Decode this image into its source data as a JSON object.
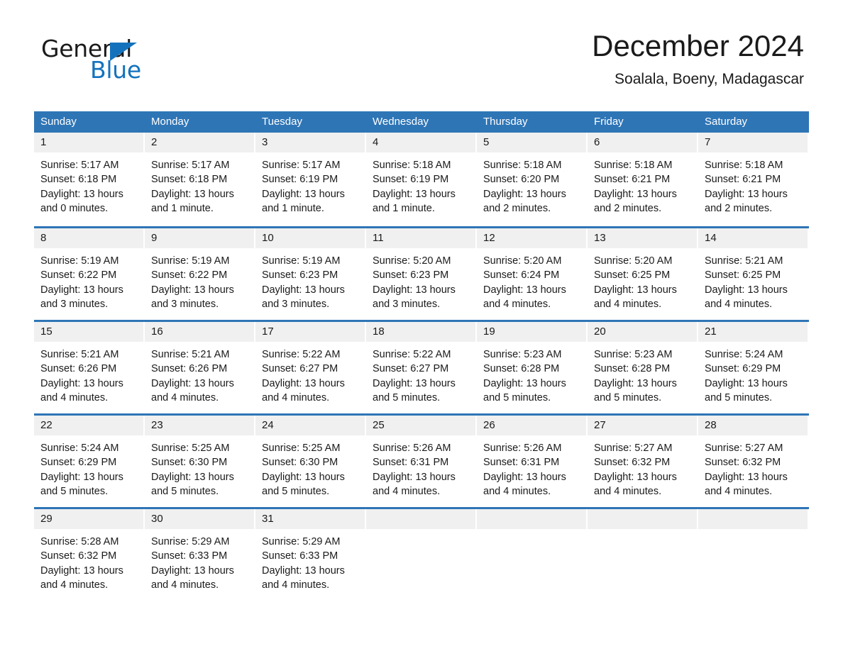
{
  "brand": {
    "name_part1": "General",
    "name_part2": "Blue",
    "triangle_icon": "triangle-icon",
    "accent_color": "#1472bd"
  },
  "header": {
    "title": "December 2024",
    "subtitle": "Soalala, Boeny, Madagascar"
  },
  "theme": {
    "header_blue": "#2e75b6",
    "day_band_gray": "#f0f0f0",
    "text_color": "#1a1a1a"
  },
  "weekdays": [
    "Sunday",
    "Monday",
    "Tuesday",
    "Wednesday",
    "Thursday",
    "Friday",
    "Saturday"
  ],
  "weeks": [
    [
      {
        "day": "1",
        "sunrise": "Sunrise: 5:17 AM",
        "sunset": "Sunset: 6:18 PM",
        "daylight": "Daylight: 13 hours and 0 minutes."
      },
      {
        "day": "2",
        "sunrise": "Sunrise: 5:17 AM",
        "sunset": "Sunset: 6:18 PM",
        "daylight": "Daylight: 13 hours and 1 minute."
      },
      {
        "day": "3",
        "sunrise": "Sunrise: 5:17 AM",
        "sunset": "Sunset: 6:19 PM",
        "daylight": "Daylight: 13 hours and 1 minute."
      },
      {
        "day": "4",
        "sunrise": "Sunrise: 5:18 AM",
        "sunset": "Sunset: 6:19 PM",
        "daylight": "Daylight: 13 hours and 1 minute."
      },
      {
        "day": "5",
        "sunrise": "Sunrise: 5:18 AM",
        "sunset": "Sunset: 6:20 PM",
        "daylight": "Daylight: 13 hours and 2 minutes."
      },
      {
        "day": "6",
        "sunrise": "Sunrise: 5:18 AM",
        "sunset": "Sunset: 6:21 PM",
        "daylight": "Daylight: 13 hours and 2 minutes."
      },
      {
        "day": "7",
        "sunrise": "Sunrise: 5:18 AM",
        "sunset": "Sunset: 6:21 PM",
        "daylight": "Daylight: 13 hours and 2 minutes."
      }
    ],
    [
      {
        "day": "8",
        "sunrise": "Sunrise: 5:19 AM",
        "sunset": "Sunset: 6:22 PM",
        "daylight": "Daylight: 13 hours and 3 minutes."
      },
      {
        "day": "9",
        "sunrise": "Sunrise: 5:19 AM",
        "sunset": "Sunset: 6:22 PM",
        "daylight": "Daylight: 13 hours and 3 minutes."
      },
      {
        "day": "10",
        "sunrise": "Sunrise: 5:19 AM",
        "sunset": "Sunset: 6:23 PM",
        "daylight": "Daylight: 13 hours and 3 minutes."
      },
      {
        "day": "11",
        "sunrise": "Sunrise: 5:20 AM",
        "sunset": "Sunset: 6:23 PM",
        "daylight": "Daylight: 13 hours and 3 minutes."
      },
      {
        "day": "12",
        "sunrise": "Sunrise: 5:20 AM",
        "sunset": "Sunset: 6:24 PM",
        "daylight": "Daylight: 13 hours and 4 minutes."
      },
      {
        "day": "13",
        "sunrise": "Sunrise: 5:20 AM",
        "sunset": "Sunset: 6:25 PM",
        "daylight": "Daylight: 13 hours and 4 minutes."
      },
      {
        "day": "14",
        "sunrise": "Sunrise: 5:21 AM",
        "sunset": "Sunset: 6:25 PM",
        "daylight": "Daylight: 13 hours and 4 minutes."
      }
    ],
    [
      {
        "day": "15",
        "sunrise": "Sunrise: 5:21 AM",
        "sunset": "Sunset: 6:26 PM",
        "daylight": "Daylight: 13 hours and 4 minutes."
      },
      {
        "day": "16",
        "sunrise": "Sunrise: 5:21 AM",
        "sunset": "Sunset: 6:26 PM",
        "daylight": "Daylight: 13 hours and 4 minutes."
      },
      {
        "day": "17",
        "sunrise": "Sunrise: 5:22 AM",
        "sunset": "Sunset: 6:27 PM",
        "daylight": "Daylight: 13 hours and 4 minutes."
      },
      {
        "day": "18",
        "sunrise": "Sunrise: 5:22 AM",
        "sunset": "Sunset: 6:27 PM",
        "daylight": "Daylight: 13 hours and 5 minutes."
      },
      {
        "day": "19",
        "sunrise": "Sunrise: 5:23 AM",
        "sunset": "Sunset: 6:28 PM",
        "daylight": "Daylight: 13 hours and 5 minutes."
      },
      {
        "day": "20",
        "sunrise": "Sunrise: 5:23 AM",
        "sunset": "Sunset: 6:28 PM",
        "daylight": "Daylight: 13 hours and 5 minutes."
      },
      {
        "day": "21",
        "sunrise": "Sunrise: 5:24 AM",
        "sunset": "Sunset: 6:29 PM",
        "daylight": "Daylight: 13 hours and 5 minutes."
      }
    ],
    [
      {
        "day": "22",
        "sunrise": "Sunrise: 5:24 AM",
        "sunset": "Sunset: 6:29 PM",
        "daylight": "Daylight: 13 hours and 5 minutes."
      },
      {
        "day": "23",
        "sunrise": "Sunrise: 5:25 AM",
        "sunset": "Sunset: 6:30 PM",
        "daylight": "Daylight: 13 hours and 5 minutes."
      },
      {
        "day": "24",
        "sunrise": "Sunrise: 5:25 AM",
        "sunset": "Sunset: 6:30 PM",
        "daylight": "Daylight: 13 hours and 5 minutes."
      },
      {
        "day": "25",
        "sunrise": "Sunrise: 5:26 AM",
        "sunset": "Sunset: 6:31 PM",
        "daylight": "Daylight: 13 hours and 4 minutes."
      },
      {
        "day": "26",
        "sunrise": "Sunrise: 5:26 AM",
        "sunset": "Sunset: 6:31 PM",
        "daylight": "Daylight: 13 hours and 4 minutes."
      },
      {
        "day": "27",
        "sunrise": "Sunrise: 5:27 AM",
        "sunset": "Sunset: 6:32 PM",
        "daylight": "Daylight: 13 hours and 4 minutes."
      },
      {
        "day": "28",
        "sunrise": "Sunrise: 5:27 AM",
        "sunset": "Sunset: 6:32 PM",
        "daylight": "Daylight: 13 hours and 4 minutes."
      }
    ],
    [
      {
        "day": "29",
        "sunrise": "Sunrise: 5:28 AM",
        "sunset": "Sunset: 6:32 PM",
        "daylight": "Daylight: 13 hours and 4 minutes."
      },
      {
        "day": "30",
        "sunrise": "Sunrise: 5:29 AM",
        "sunset": "Sunset: 6:33 PM",
        "daylight": "Daylight: 13 hours and 4 minutes."
      },
      {
        "day": "31",
        "sunrise": "Sunrise: 5:29 AM",
        "sunset": "Sunset: 6:33 PM",
        "daylight": "Daylight: 13 hours and 4 minutes."
      },
      {
        "day": "",
        "sunrise": "",
        "sunset": "",
        "daylight": ""
      },
      {
        "day": "",
        "sunrise": "",
        "sunset": "",
        "daylight": ""
      },
      {
        "day": "",
        "sunrise": "",
        "sunset": "",
        "daylight": ""
      },
      {
        "day": "",
        "sunrise": "",
        "sunset": "",
        "daylight": ""
      }
    ]
  ]
}
